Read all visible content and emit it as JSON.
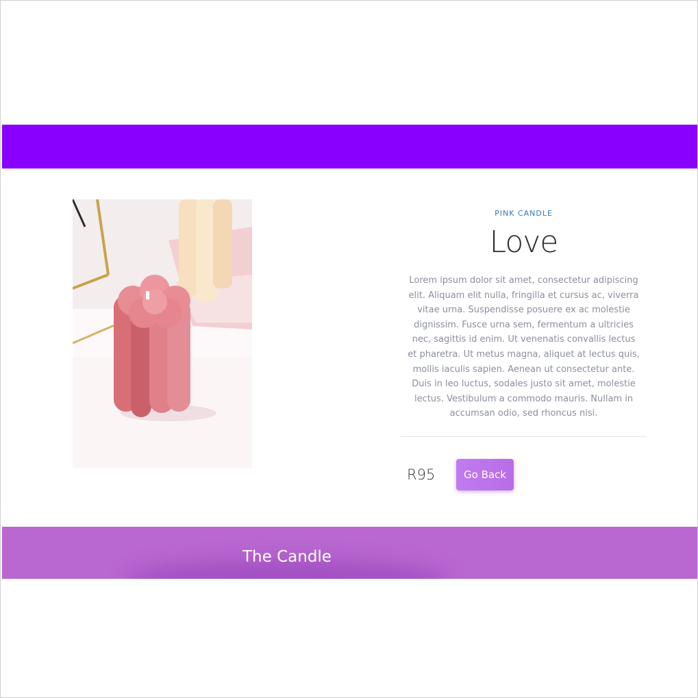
{
  "product": {
    "category": "PINK CANDLE",
    "title": "Love",
    "description": "Lorem ipsum dolor sit amet, consectetur adipiscing elit. Aliquam elit nulla, fringilla et cursus ac, viverra vitae urna. Suspendisse posuere ex ac molestie dignissim. Fusce urna sem, fermentum a ultricies nec, sagittis id enim. Ut venenatis convallis lectus et pharetra. Ut metus magna, aliquet at lectus quis, mollis iaculis sapien. Aenean ut consectetur ante. Duis in leo luctus, sodales justo sit amet, molestie lectus. Vestibulum a commodo mauris. Nullam in accumsan odio, sed rhoncus nisi.",
    "price": "R95",
    "image_icon": "pink-flower-candle-photo"
  },
  "actions": {
    "go_back_label": "Go Back"
  },
  "footer": {
    "title": "The Candle"
  },
  "colors": {
    "top_bar": "#8a00ff",
    "footer": "#b967d1",
    "button": "#c07cf2",
    "category_text": "#2f7cb8"
  }
}
